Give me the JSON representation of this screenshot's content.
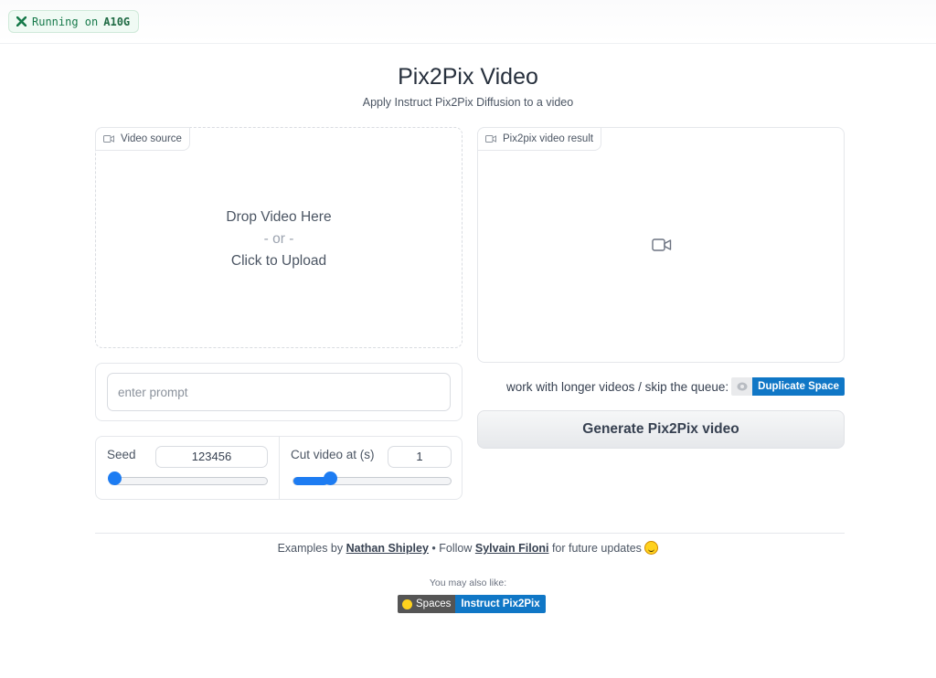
{
  "status": {
    "prefix": "Running on",
    "hardware": "A10G"
  },
  "header": {
    "title": "Pix2Pix Video",
    "subtitle": "Apply Instruct Pix2Pix Diffusion to a video"
  },
  "video_source": {
    "label": "Video source",
    "drop_line1": "Drop Video Here",
    "drop_line2": "- or -",
    "drop_line3": "Click to Upload"
  },
  "video_result": {
    "label": "Pix2pix video result"
  },
  "prompt": {
    "placeholder": "enter prompt",
    "value": ""
  },
  "seed": {
    "label": "Seed",
    "value": "123456",
    "level": 0.0
  },
  "cut_video": {
    "label": "Cut video at (s)",
    "value": "1",
    "level": 0.22
  },
  "duplicate": {
    "text": "work with longer videos / skip the queue:",
    "badge_label": "Duplicate Space"
  },
  "generate_button": {
    "label": "Generate Pix2Pix video"
  },
  "footer": {
    "examples_prefix": "Examples by",
    "examples_author": "Nathan Shipley",
    "follow_prefix": "• Follow",
    "follow_author": "Sylvain Filoni",
    "follow_suffix": "for future updates",
    "also_like": "You may also like:",
    "spaces_badge_left": "Spaces",
    "spaces_badge_right": "Instruct Pix2Pix"
  },
  "colors": {
    "accent": "#1d7cf2",
    "badge_blue": "#1077c6",
    "running_green": "#16794a"
  }
}
